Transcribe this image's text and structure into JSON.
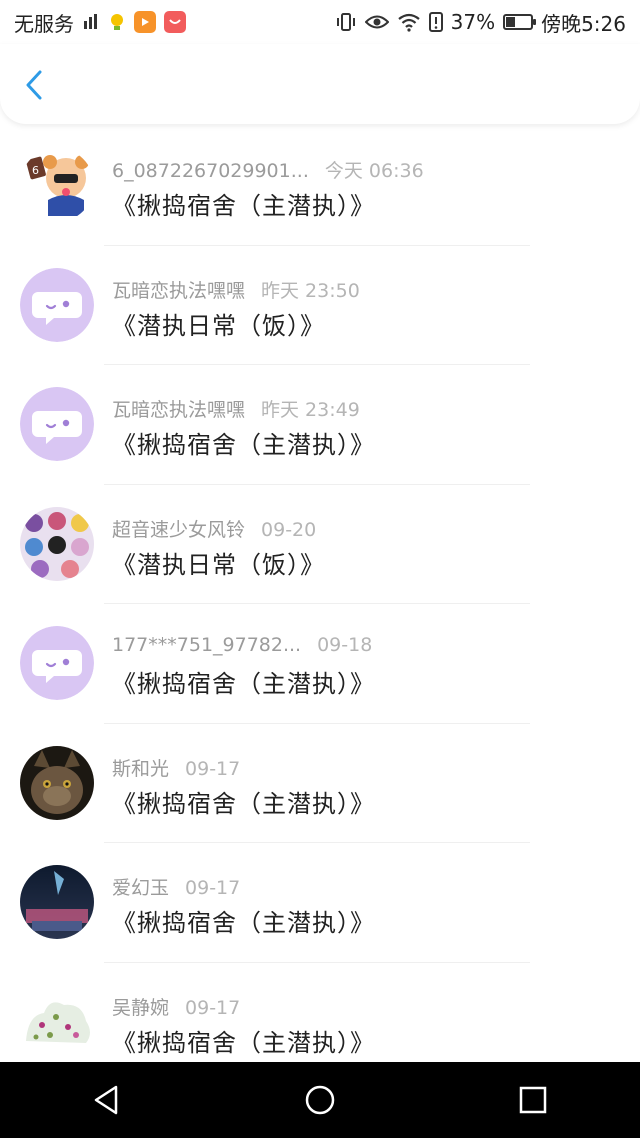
{
  "status_bar": {
    "carrier": "无服务",
    "battery": "37%",
    "battery_level": 0.37,
    "time": "傍晚5:26",
    "icons": [
      "signal-icon",
      "bulb-icon",
      "video-app-icon",
      "huawei-app-icon",
      "vibrate-icon",
      "eye-icon",
      "wifi-icon",
      "alert-icon",
      "battery-icon"
    ]
  },
  "header": {
    "back_icon": "chevron-left-icon"
  },
  "messages": [
    {
      "name": "6_0872267029901...",
      "time": "今天 06:36",
      "text": "《揪捣宿舍（主潜执）》",
      "avatar": "anime-avatar"
    },
    {
      "name": "瓦暗恋执法嘿嘿",
      "time": "昨天 23:50",
      "text": "《潜执日常（饭）》",
      "avatar": "default-chat-avatar"
    },
    {
      "name": "瓦暗恋执法嘿嘿",
      "time": "昨天 23:49",
      "text": "《揪捣宿舍（主潜执）》",
      "avatar": "default-chat-avatar"
    },
    {
      "name": "超音速少女风铃",
      "time": "09-20",
      "text": "《潜执日常（饭）》",
      "avatar": "collage-avatar"
    },
    {
      "name": "177***751_97782...",
      "time": "09-18",
      "text": "《揪捣宿舍（主潜执）》",
      "avatar": "default-chat-avatar"
    },
    {
      "name": "斯和光",
      "time": "09-17",
      "text": "《揪捣宿舍（主潜执）》",
      "avatar": "cat-avatar"
    },
    {
      "name": "爱幻玉",
      "time": "09-17",
      "text": "《揪捣宿舍（主潜执）》",
      "avatar": "night-sky-avatar"
    },
    {
      "name": "吴静婉",
      "time": "09-17",
      "text": "《揪捣宿舍（主潜执）》",
      "avatar": "floral-avatar"
    }
  ],
  "nav_bar": {
    "icons": [
      "back-triangle-icon",
      "home-circle-icon",
      "recents-square-icon"
    ]
  },
  "colors": {
    "accent": "#2e9be6",
    "avatar_default": "#d9c6f3",
    "avatar_default_fg": "#a07fd6"
  }
}
